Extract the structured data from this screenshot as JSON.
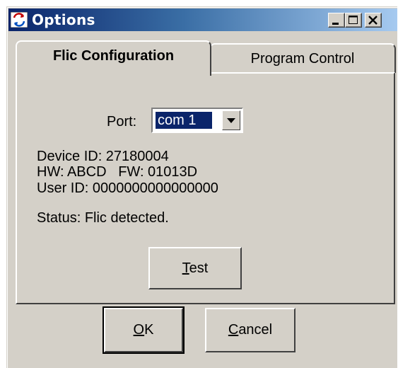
{
  "window": {
    "title": "Options",
    "controls": [
      "minimize",
      "maximize",
      "close"
    ]
  },
  "tabs": [
    {
      "label": "Flic Configuration",
      "active": true
    },
    {
      "label": "Program Control",
      "active": false
    }
  ],
  "config": {
    "port_label": "Port:",
    "port_value": "com 1",
    "device_id": "Device ID: 27180004",
    "hw_fw": "HW: ABCD   FW: 01013D",
    "user_id": "User ID: 0000000000000000",
    "status": "Status: Flic detected."
  },
  "buttons": {
    "test": {
      "mnemonic": "T",
      "rest": "est"
    },
    "ok": {
      "mnemonic": "O",
      "rest": "K"
    },
    "cancel": {
      "mnemonic": "C",
      "rest": "ancel"
    }
  },
  "colors": {
    "face": "#d4d0c8",
    "title_start": "#0a246a",
    "title_end": "#a6caf0",
    "selection": "#0a246a"
  }
}
